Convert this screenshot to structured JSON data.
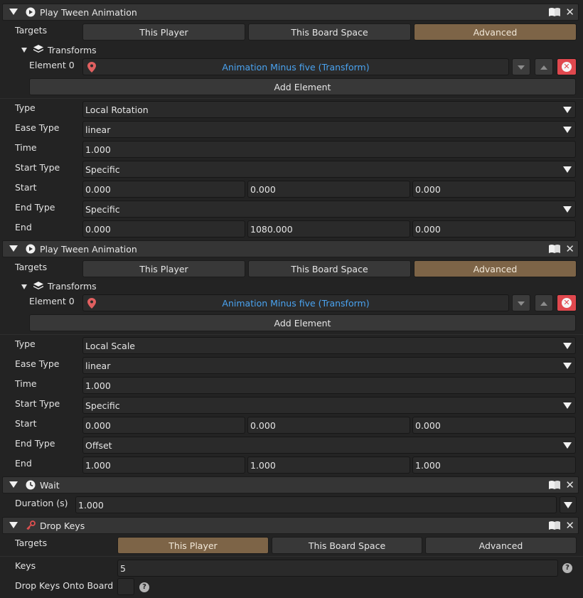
{
  "block1": {
    "title": "Play Tween Animation",
    "targets_label": "Targets",
    "tabs": [
      "This Player",
      "This Board Space",
      "Advanced"
    ],
    "transforms_label": "Transforms",
    "element_label": "Element 0",
    "element_value": "Animation Minus five (Transform)",
    "add_element": "Add Element",
    "type_label": "Type",
    "type_value": "Local Rotation",
    "ease_label": "Ease Type",
    "ease_value": "linear",
    "time_label": "Time",
    "time_value": "1.000",
    "start_type_label": "Start Type",
    "start_type_value": "Specific",
    "start_label": "Start",
    "start_values": [
      "0.000",
      "0.000",
      "0.000"
    ],
    "end_type_label": "End Type",
    "end_type_value": "Specific",
    "end_label": "End",
    "end_values": [
      "0.000",
      "1080.000",
      "0.000"
    ]
  },
  "block2": {
    "title": "Play Tween Animation",
    "targets_label": "Targets",
    "tabs": [
      "This Player",
      "This Board Space",
      "Advanced"
    ],
    "transforms_label": "Transforms",
    "element_label": "Element 0",
    "element_value": "Animation Minus five (Transform)",
    "add_element": "Add Element",
    "type_label": "Type",
    "type_value": "Local Scale",
    "ease_label": "Ease Type",
    "ease_value": "linear",
    "time_label": "Time",
    "time_value": "1.000",
    "start_type_label": "Start Type",
    "start_type_value": "Specific",
    "start_label": "Start",
    "start_values": [
      "0.000",
      "0.000",
      "0.000"
    ],
    "end_type_label": "End Type",
    "end_type_value": "Offset",
    "end_label": "End",
    "end_values": [
      "1.000",
      "1.000",
      "1.000"
    ]
  },
  "wait": {
    "title": "Wait",
    "duration_label": "Duration (s)",
    "duration_value": "1.000"
  },
  "drop": {
    "title": "Drop Keys",
    "targets_label": "Targets",
    "tabs": [
      "This Player",
      "This Board Space",
      "Advanced"
    ],
    "keys_label": "Keys",
    "keys_value": "5",
    "onto_board_label": "Drop Keys Onto Board"
  },
  "icons": {
    "play": "play-circle-icon",
    "book": "book-icon",
    "close": "close-icon",
    "layers": "layers-icon",
    "pin": "location-pin-icon",
    "clock": "clock-icon",
    "key": "key-icon",
    "help": "help-icon"
  },
  "colors": {
    "active_tab": "#7d6447",
    "object_link": "#4aa3f0",
    "delete": "#e0484e"
  }
}
